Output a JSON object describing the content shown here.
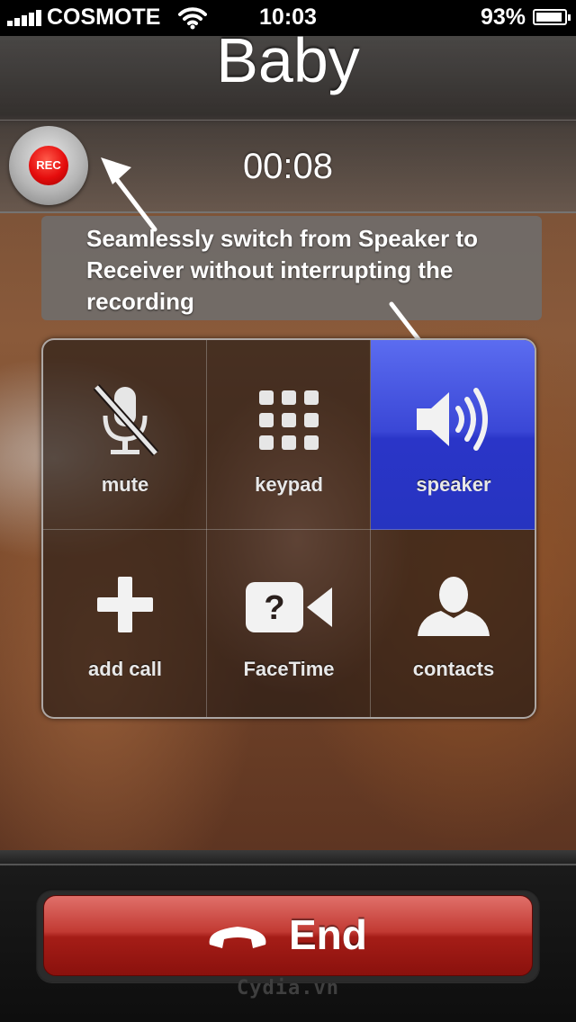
{
  "status_bar": {
    "carrier": "COSMOTE",
    "time": "10:03",
    "battery_percent": "93%",
    "battery_level": 0.93,
    "signal_bars": 5,
    "wifi_icon": "wifi-icon"
  },
  "call": {
    "contact_name": "Baby",
    "duration": "00:08"
  },
  "recorder": {
    "badge": "REC"
  },
  "tooltip": {
    "text": "Seamlessly switch from Speaker to Receiver without interrupting the recording"
  },
  "controls": [
    {
      "label": "mute",
      "icon": "mute-icon",
      "active": false
    },
    {
      "label": "keypad",
      "icon": "keypad-icon",
      "active": false
    },
    {
      "label": "speaker",
      "icon": "speaker-icon",
      "active": true
    },
    {
      "label": "add call",
      "icon": "add-call-icon",
      "active": false
    },
    {
      "label": "FaceTime",
      "icon": "facetime-icon",
      "active": false
    },
    {
      "label": "contacts",
      "icon": "contacts-icon",
      "active": false
    }
  ],
  "end_button": {
    "label": "End",
    "icon": "handset-icon",
    "color": "#b0201a"
  },
  "watermark": "Cydia.vn",
  "colors": {
    "speaker_active": "#3a47d6",
    "rec_red": "#e50d0d"
  }
}
